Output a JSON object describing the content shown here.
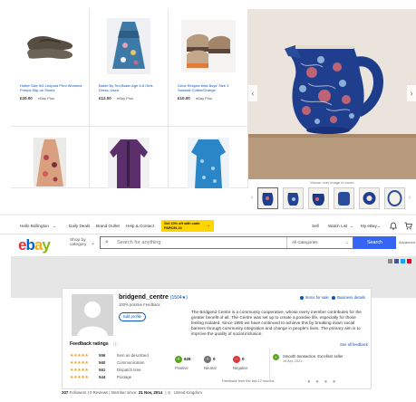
{
  "listings": [
    {
      "title": "Hotter Size 5/6 Leopard Print Womens Pumps Slip-on Shoes",
      "price": "£20.00",
      "ship": "eBay Plus"
    },
    {
      "title": "Baker By Ted Baker Age 5-6 Girls Dress, Used",
      "price": "£12.00",
      "ship": "eBay Plus"
    },
    {
      "title": "Geox Respira Kids Boys' Size 3 Sandals Coffee/Orange",
      "price": "£10.00",
      "ship": "eBay Plus"
    }
  ],
  "viewer": {
    "hover_hint": "Mouse over image to zoom",
    "prev_icon": "chevron-left-icon",
    "next_icon": "chevron-right-icon",
    "thumb_count": 6
  },
  "topbar": {
    "greeting": "Hello Bollington",
    "daily_deals": "Daily Deals",
    "brand_outlet": "Brand Outlet",
    "help": "Help & Contact",
    "promo": "Get 10% off with code PARCEL10",
    "sell": "Sell",
    "watch_list": "Watch List",
    "my_ebay": "My eBay",
    "bell_icon": "bell-icon",
    "cart_icon": "cart-icon"
  },
  "header": {
    "logo_letters": [
      "e",
      "b",
      "a",
      "y"
    ],
    "logo_colors": [
      "#e53238",
      "#0064d2",
      "#f5af02",
      "#86b817"
    ],
    "shop_by": "Shop by category",
    "search_placeholder": "Search for anything",
    "category": "All Categories",
    "search_button": "Search",
    "advanced": "Advanced"
  },
  "profile": {
    "username": "bridgend_centre",
    "score": "(1504★)",
    "positive": "100% positive Feedback",
    "edit_profile": "Edit profile",
    "items_for_sale": "Items for sale",
    "business_details": "Business details",
    "description": "The Bridgend Centre is a community cooperative, whose every member contributes for the greater benefit of all. The Centre was set up to create a positive life, especially for those feeling isolated. Since 1990 we have continued to achieve this by breaking down social barriers through community integration and change in people's lives. The primary aim is to improve the quality of social inclusion."
  },
  "feedback": {
    "heading": "Feedback ratings",
    "ratings": [
      {
        "count": "556",
        "label": "Item as described"
      },
      {
        "count": "560",
        "label": "Communication"
      },
      {
        "count": "561",
        "label": "Dispatch time"
      },
      {
        "count": "544",
        "label": "Postage"
      }
    ],
    "positive_count": "626",
    "positive_label": "Positive",
    "neutral_count": "0",
    "neutral_label": "Neutral",
    "negative_count": "0",
    "negative_label": "Negative",
    "note": "Feedback from the last 12 months",
    "see_all": "See all feedback",
    "comment": "Smooth transaction. Excellent seller",
    "comment_date": "19 Apr, 2021"
  },
  "footer": {
    "followers": "207",
    "followers_label": "Followers",
    "reviews": "| 0 Reviews |",
    "member_since_label": "Member since:",
    "member_since": "21 Nov, 2014",
    "location": "United Kingdom"
  },
  "colors": {
    "link": "#0654ba",
    "search_button": "#3665f3",
    "promo": "#ffd500",
    "star": "#f0a20d"
  }
}
